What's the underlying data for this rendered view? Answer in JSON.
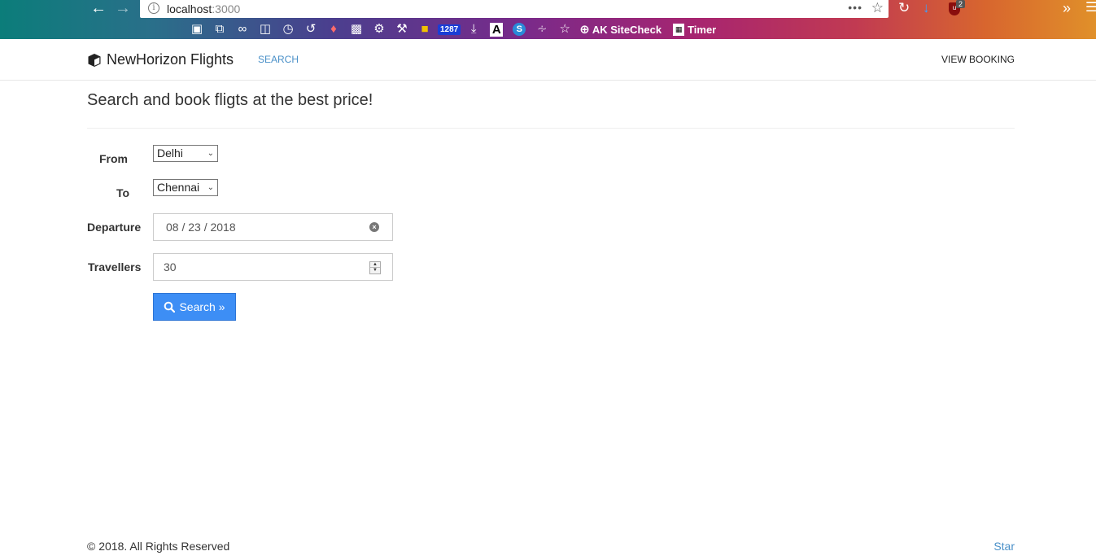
{
  "browser": {
    "url_host": "localhost",
    "url_port": ":3000",
    "overflow_dots": "•••",
    "ublock_badge": "2",
    "bookmark_badge": "1287",
    "bookmark_a": "A",
    "bookmark_s": "S",
    "bookmark_sitecheck": "AK SiteCheck",
    "bookmark_timer": "Timer"
  },
  "navbar": {
    "brand": "NewHorizon Flights",
    "search_link": "SEARCH",
    "view_booking_link": "VIEW BOOKING"
  },
  "main": {
    "heading": "Search and book fligts at the best price!",
    "from_label": "From",
    "from_value": "Delhi",
    "to_label": "To",
    "to_value": "Chennai",
    "departure_label": "Departure",
    "departure_value": "08 / 23 / 2018",
    "travellers_label": "Travellers",
    "travellers_value": "30",
    "search_button": "Search »"
  },
  "footer": {
    "copyright": "© 2018. All Rights Reserved",
    "star_link": "Star"
  },
  "colors": {
    "accent": "#3d8ef5",
    "link": "#4a90c8"
  }
}
